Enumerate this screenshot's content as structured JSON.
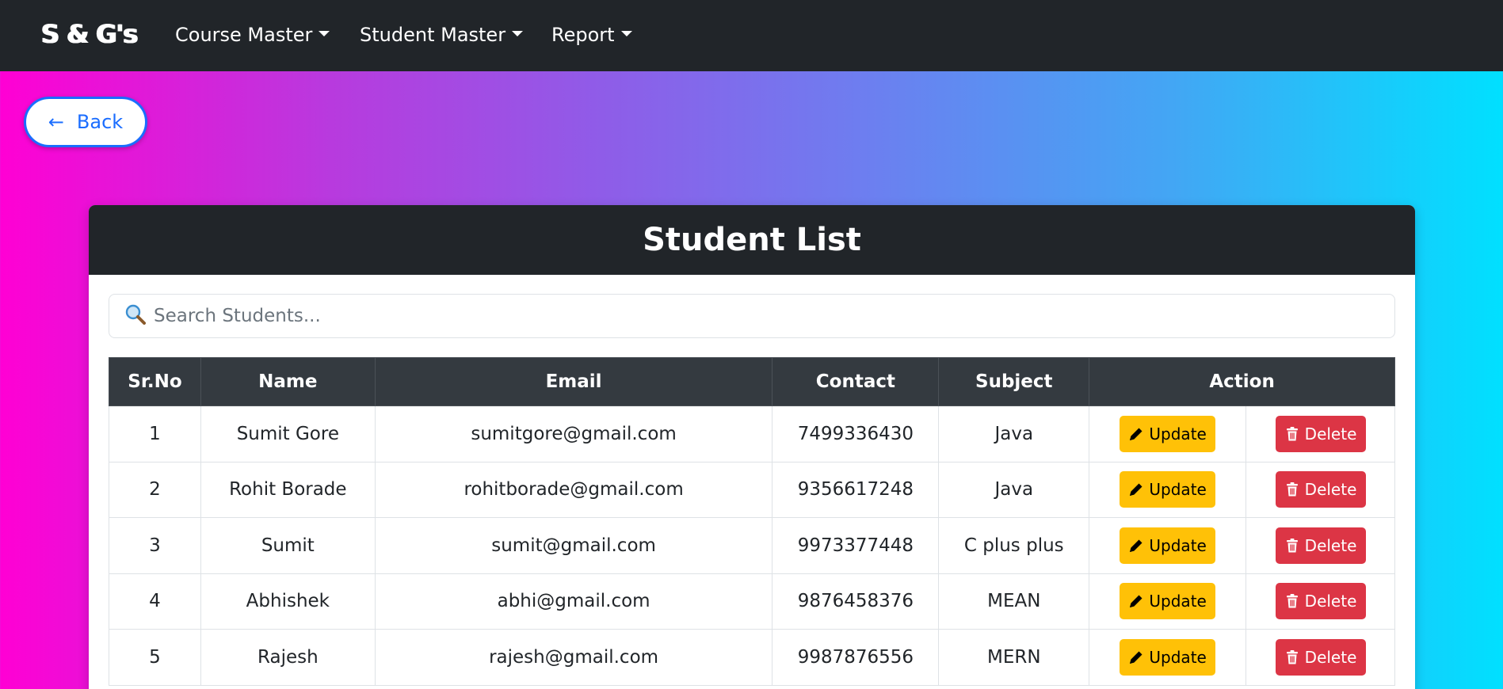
{
  "navbar": {
    "brand": "S & G's",
    "items": [
      {
        "label": "Course Master"
      },
      {
        "label": "Student Master"
      },
      {
        "label": "Report"
      }
    ]
  },
  "back_button": {
    "arrow": "←",
    "label": "Back"
  },
  "card": {
    "title": "Student List",
    "search_placeholder": "Search Students...",
    "search_value": ""
  },
  "table": {
    "headers": [
      "Sr.No",
      "Name",
      "Email",
      "Contact",
      "Subject",
      "Action"
    ],
    "update_label": "Update",
    "delete_label": "Delete",
    "rows": [
      {
        "srno": "1",
        "name": "Sumit Gore",
        "email": "sumitgore@gmail.com",
        "contact": "7499336430",
        "subject": "Java"
      },
      {
        "srno": "2",
        "name": "Rohit Borade",
        "email": "rohitborade@gmail.com",
        "contact": "9356617248",
        "subject": "Java"
      },
      {
        "srno": "3",
        "name": "Sumit",
        "email": "sumit@gmail.com",
        "contact": "9973377448",
        "subject": "C plus plus"
      },
      {
        "srno": "4",
        "name": "Abhishek",
        "email": "abhi@gmail.com",
        "contact": "9876458376",
        "subject": "MEAN"
      },
      {
        "srno": "5",
        "name": "Rajesh",
        "email": "rajesh@gmail.com",
        "contact": "9987876556",
        "subject": "MERN"
      }
    ]
  },
  "colors": {
    "navbar_bg": "#212529",
    "update_btn": "#ffc107",
    "delete_btn": "#dc3545",
    "back_btn_border": "#1a6dff"
  },
  "icons": {
    "search": "magnifier-icon",
    "update": "pencil-icon",
    "delete": "trash-icon"
  }
}
